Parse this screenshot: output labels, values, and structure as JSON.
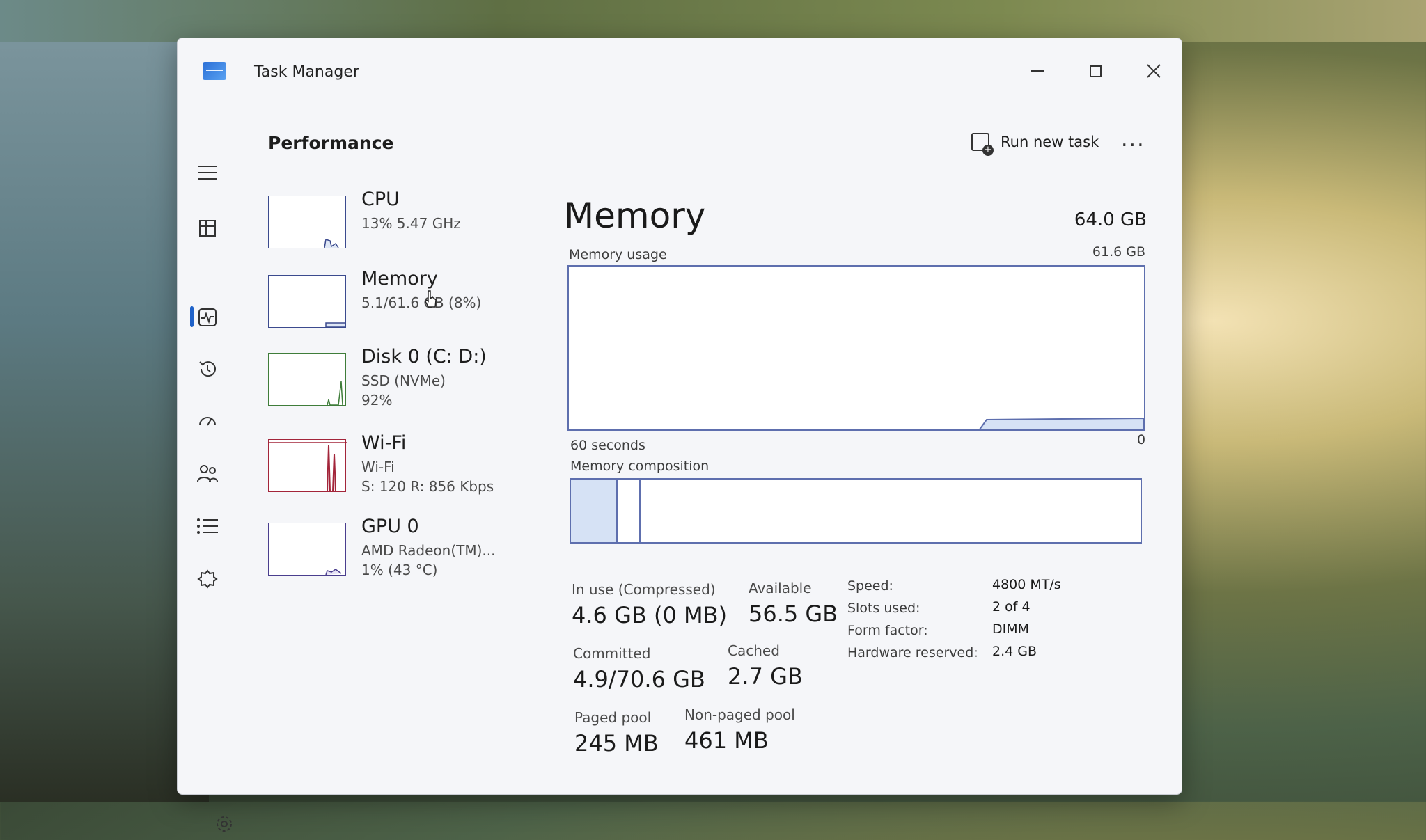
{
  "window": {
    "title": "Task Manager"
  },
  "header": {
    "title": "Performance",
    "run_new_task": "Run new task",
    "more": "..."
  },
  "sidebar_items": [
    {
      "name": "CPU",
      "sub1": "13%  5.47 GHz",
      "sub2": ""
    },
    {
      "name": "Memory",
      "sub1": "5.1/61.6 GB (8%)",
      "sub2": ""
    },
    {
      "name": "Disk 0 (C: D:)",
      "sub1": "SSD (NVMe)",
      "sub2": "92%"
    },
    {
      "name": "Wi-Fi",
      "sub1": "Wi-Fi",
      "sub2": "S: 120  R: 856 Kbps"
    },
    {
      "name": "GPU 0",
      "sub1": "AMD Radeon(TM)...",
      "sub2": "1% (43 °C)"
    }
  ],
  "memory": {
    "title": "Memory",
    "total": "64.0 GB",
    "usage_label": "Memory usage",
    "usage_max": "61.6 GB",
    "time_left": "60 seconds",
    "time_right": "0",
    "composition_label": "Memory composition",
    "in_use_fraction": 0.08,
    "stats": {
      "in_use_label": "In use (Compressed)",
      "in_use_value": "4.6 GB (0 MB)",
      "available_label": "Available",
      "available_value": "56.5 GB",
      "committed_label": "Committed",
      "committed_value": "4.9/70.6 GB",
      "cached_label": "Cached",
      "cached_value": "2.7 GB",
      "paged_label": "Paged pool",
      "paged_value": "245 MB",
      "nonpaged_label": "Non-paged pool",
      "nonpaged_value": "461 MB"
    },
    "specs": {
      "speed_label": "Speed:",
      "speed_value": "4800 MT/s",
      "slots_label": "Slots used:",
      "slots_value": "2 of 4",
      "form_label": "Form factor:",
      "form_value": "DIMM",
      "reserved_label": "Hardware reserved:",
      "reserved_value": "2.4 GB"
    }
  },
  "colors": {
    "accent": "#1f62c9",
    "graph_border": "#5e6fae",
    "graph_fill": "#d6e2f5",
    "wifi_line": "#a3253a"
  }
}
